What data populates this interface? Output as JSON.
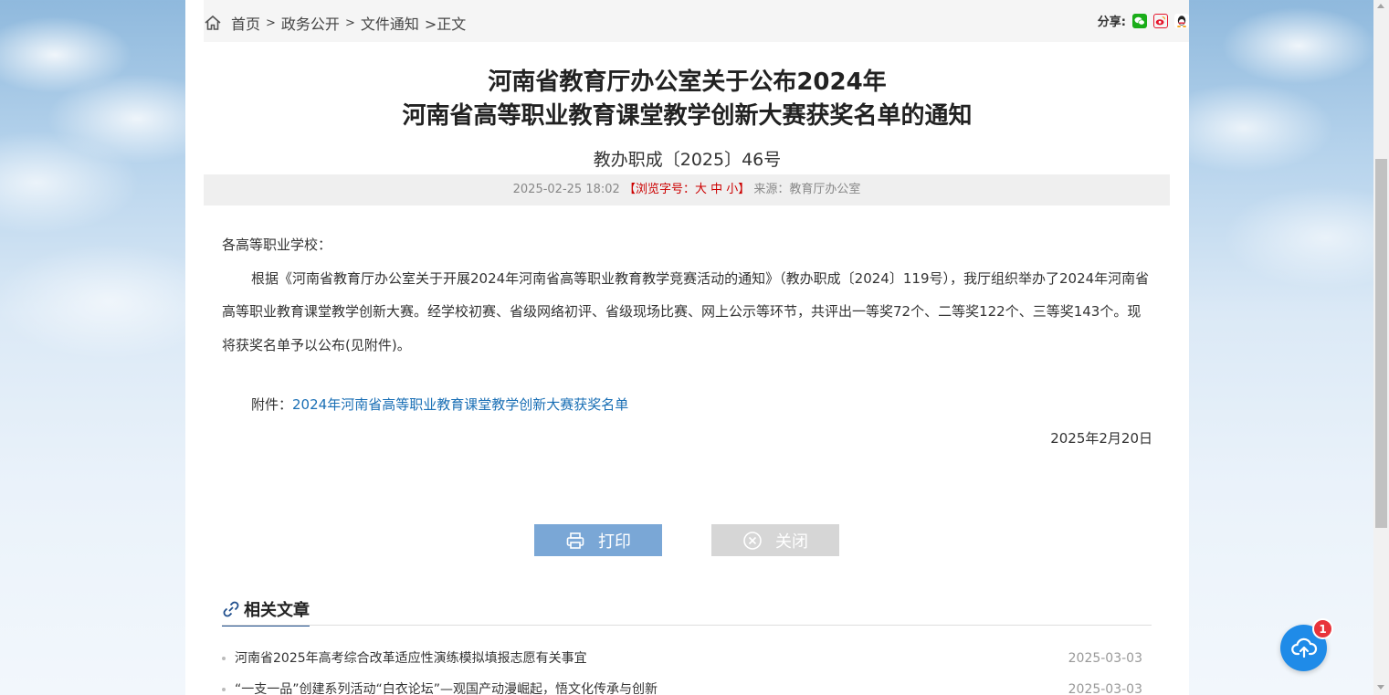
{
  "breadcrumb": {
    "items": [
      "首页",
      "政务公开",
      "文件通知"
    ],
    "sep": ">",
    "current": ">正文"
  },
  "share": {
    "label": "分享:"
  },
  "article": {
    "title_line1": "河南省教育厅办公室关于公布2024年",
    "title_line2": "河南省高等职业教育课堂教学创新大赛获奖名单的通知",
    "doc_number": "教办职成〔2025〕46号",
    "meta": {
      "datetime": "2025-02-25 18:02",
      "font_size_label": "【浏览字号：大 中 小】",
      "source": "来源：教育厅办公室"
    },
    "salutation": "各高等职业学校：",
    "paragraph": "根据《河南省教育厅办公室关于开展2024年河南省高等职业教育教学竞赛活动的通知》（教办职成〔2024〕119号），我厅组织举办了2024年河南省高等职业教育课堂教学创新大赛。经学校初赛、省级网络初评、省级现场比赛、网上公示等环节，共评出一等奖72个、二等奖122个、三等奖143个。现将获奖名单予以公布(见附件)。",
    "attachment_label": "附件：",
    "attachment_link": "2024年河南省高等职业教育课堂教学创新大赛获奖名单",
    "date": "2025年2月20日"
  },
  "buttons": {
    "print": "打印",
    "close": "关闭"
  },
  "related": {
    "heading": "相关文章",
    "items": [
      {
        "title": "河南省2025年高考综合改革适应性演练模拟填报志愿有关事宜",
        "date": "2025-03-03"
      },
      {
        "title": "“一支一品”创建系列活动“白衣论坛”—观国产动漫崛起，悟文化传承与创新",
        "date": "2025-03-03"
      }
    ]
  },
  "float_badge": "1",
  "colors": {
    "accent": "#1a6fb5",
    "print_button": "#7aa7d6",
    "close_button": "#d6d6d6",
    "highlight": "#cc0000",
    "float_button": "#1f8be8"
  }
}
